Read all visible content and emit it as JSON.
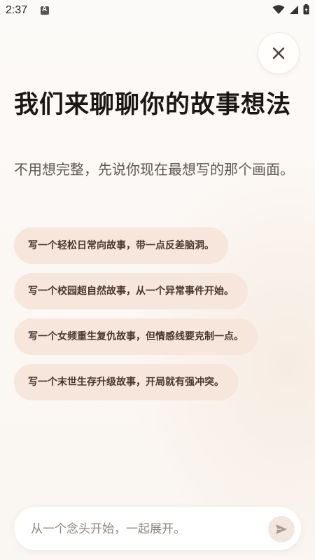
{
  "status_bar": {
    "time": "2:37",
    "icons": [
      "app-notification-icon",
      "wifi-icon",
      "signal-icon",
      "battery-icon"
    ]
  },
  "header": {
    "close_icon": "close-icon"
  },
  "main": {
    "title": "我们来聊聊你的故事想法",
    "subtitle": "不用想完整，先说你现在最想写的那个画面。"
  },
  "suggestions": [
    {
      "label": "写一个轻松日常向故事，带一点反差脑洞。"
    },
    {
      "label": "写一个校园超自然故事，从一个异常事件开始。"
    },
    {
      "label": "写一个女频重生复仇故事，但情感线要克制一点。"
    },
    {
      "label": "写一个末世生存升级故事，开局就有强冲突。"
    }
  ],
  "composer": {
    "placeholder": "从一个念头开始，一起展开。",
    "value": "",
    "send_icon": "send-icon"
  },
  "colors": {
    "chip_background": "#f6e6dc",
    "chip_text": "#4a3830",
    "title": "#1b1714",
    "subtitle": "#5f5852"
  }
}
